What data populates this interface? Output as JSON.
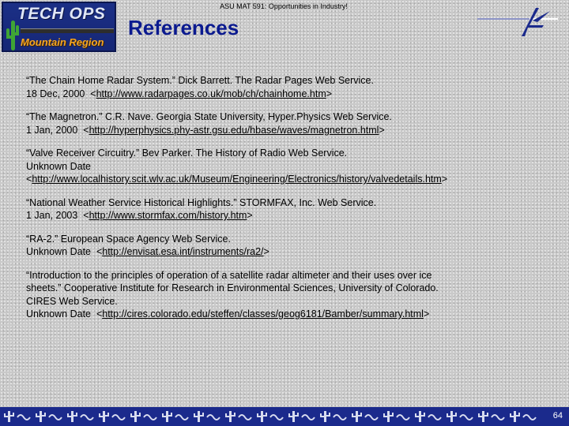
{
  "header": {
    "course": "ASU MAT 591: Opportunities in Industry!",
    "title": "References",
    "logo_top": "TECH OPS",
    "logo_bottom": "Mountain Region"
  },
  "references": [
    {
      "line1": "“The Chain Home Radar System.” Dick Barrett. The Radar Pages Web Service.",
      "date": "18 Dec, 2000",
      "url": "http://www.radarpages.co.uk/mob/ch/chainhome.htm"
    },
    {
      "line1": "“The Magnetron.” C.R. Nave. Georgia State University, Hyper.Physics Web Service.",
      "date": "1 Jan, 2000",
      "url": "http://hyperphysics.phy-astr.gsu.edu/hbase/waves/magnetron.html"
    },
    {
      "line1": "“Valve Receiver Circuitry.” Bev Parker. The History of Radio Web Service.",
      "date": "Unknown Date",
      "url": "http://www.localhistory.scit.wlv.ac.uk/Museum/Engineering/Electronics/history/valvedetails.htm"
    },
    {
      "line1": "“National Weather Service Historical Highlights.” STORMFAX, Inc. Web Service.",
      "date": "1 Jan, 2003",
      "url": "http://www.stormfax.com/history.htm"
    },
    {
      "line1": "“RA-2.” European Space Agency Web Service.",
      "date": "Unknown Date",
      "url": "http://envisat.esa.int/instruments/ra2/"
    },
    {
      "line1": "“Introduction to the principles of operation of a satellite radar altimeter and their uses over ice",
      "line2": "sheets.” Cooperative Institute for Research in Environmental Sciences, University of Colorado.",
      "line3": "CIRES Web Service.",
      "date": "Unknown Date",
      "url": "http://cires.colorado.edu/steffen/classes/geog6181/Bamber/summary.html"
    }
  ],
  "footer": {
    "page_number": "64"
  },
  "colors": {
    "title": "#0b1a8f",
    "footer_bar": "#1b2a8c",
    "logo_bg": "#1b2f86",
    "logo_accent": "#f5a623"
  },
  "icons": [
    "cactus-icon",
    "lockheed-star-icon",
    "saguaro-footer-icon"
  ]
}
